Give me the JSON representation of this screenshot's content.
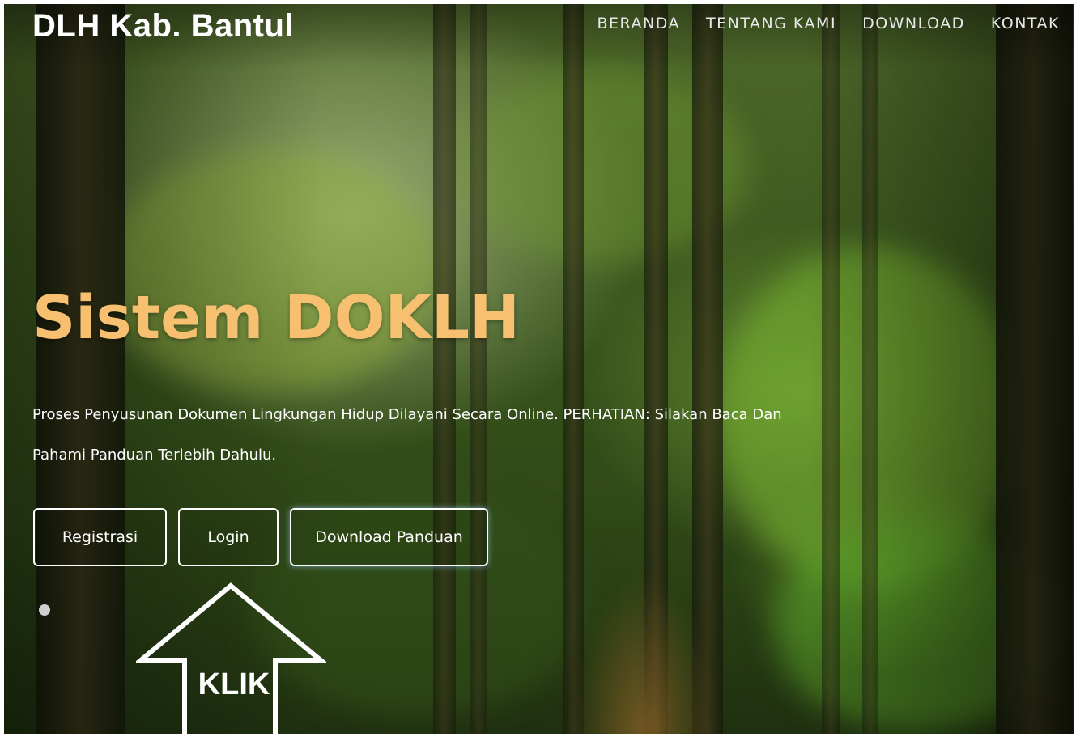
{
  "header": {
    "brand": "DLH Kab. Bantul",
    "nav": [
      "BERANDA",
      "TENTANG KAMI",
      "DOWNLOAD",
      "KONTAK"
    ]
  },
  "hero": {
    "title": "Sistem DOKLH",
    "description": "Proses Penyusunan Dokumen Lingkungan Hidup Dilayani Secara Online. PERHATIAN: Silakan Baca Dan Pahami Panduan Terlebih Dahulu.",
    "buttons": {
      "registrasi": "Registrasi",
      "login": "Login",
      "download_panduan": "Download Panduan"
    }
  },
  "annotation": {
    "arrow_label": "KLIK"
  },
  "colors": {
    "title": "#f6c070",
    "text": "#ffffff"
  }
}
